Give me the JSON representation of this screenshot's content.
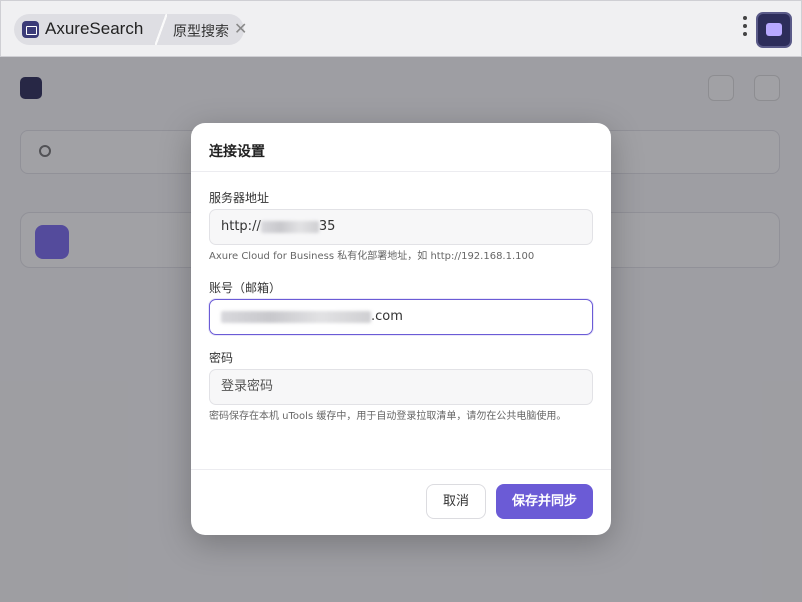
{
  "app": {
    "name": "AxureSearch",
    "tab_label": "原型搜索",
    "close_glyph": "✕"
  },
  "dialog": {
    "title": "连接设置",
    "server": {
      "label": "服务器地址",
      "value_prefix": "http://",
      "value_suffix": "35",
      "hint": "Axure Cloud for Business 私有化部署地址，如 http://192.168.1.100"
    },
    "account": {
      "label": "账号（邮箱）",
      "value_suffix": ".com"
    },
    "password": {
      "label": "密码",
      "placeholder": "登录密码",
      "hint": "密码保存在本机 uTools 缓存中，用于自动登录拉取清单，请勿在公共电脑使用。"
    },
    "cancel_label": "取消",
    "save_label": "保存并同步"
  },
  "colors": {
    "accent": "#6b5bd6",
    "overlay": "rgba(30,30,40,0.42)"
  },
  "icons": [
    "app-logo-icon",
    "close-icon",
    "kebab-menu-icon",
    "corner-app-icon"
  ]
}
